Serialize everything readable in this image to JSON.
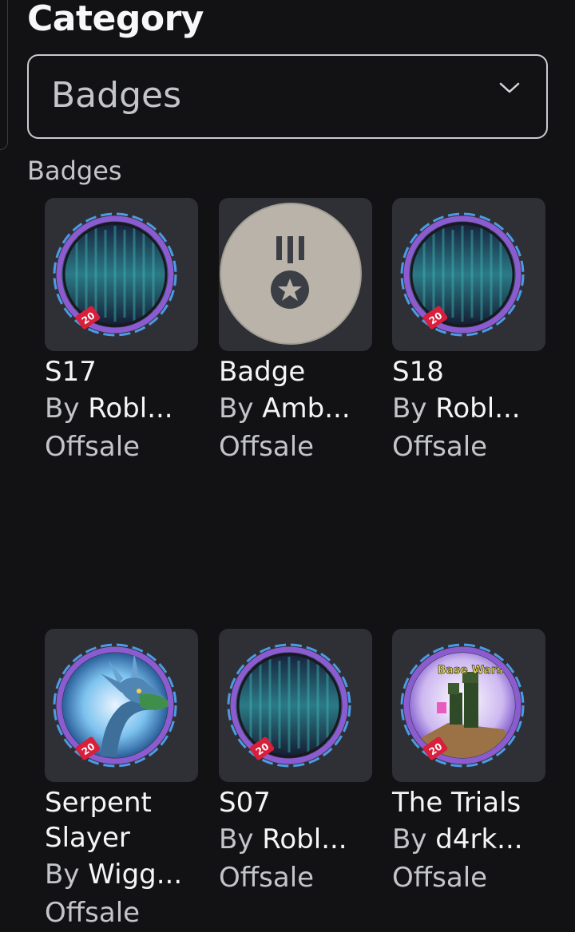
{
  "category": {
    "title": "Category",
    "selected": "Badges"
  },
  "section": {
    "label": "Badges"
  },
  "items": [
    {
      "name": "S17",
      "by": "By",
      "creator": "Robl...",
      "price": "Offsale",
      "icon": "season-badge-icon"
    },
    {
      "name": "Badge",
      "by": "By",
      "creator": "Amb...",
      "price": "Offsale",
      "icon": "default-medal-badge-icon"
    },
    {
      "name": "S18",
      "by": "By",
      "creator": "Robl...",
      "price": "Offsale",
      "icon": "season-badge-icon"
    },
    {
      "name": "Serpent Slayer",
      "by": "By",
      "creator": "Wigg...",
      "price": "Offsale",
      "icon": "dragon-badge-icon"
    },
    {
      "name": "S07",
      "by": "By",
      "creator": "Robl...",
      "price": "Offsale",
      "icon": "season-badge-icon"
    },
    {
      "name": "The Trials",
      "by": "By",
      "creator": "d4rk...",
      "price": "Offsale",
      "icon": "base-wars-badge-icon"
    }
  ],
  "badge_text": {
    "year_tag": "20",
    "base_wars": "Base Wars"
  },
  "colors": {
    "background": "#121215",
    "card": "#2f3036",
    "ring": "#8a5cd0",
    "tag": "#d81f3b"
  }
}
